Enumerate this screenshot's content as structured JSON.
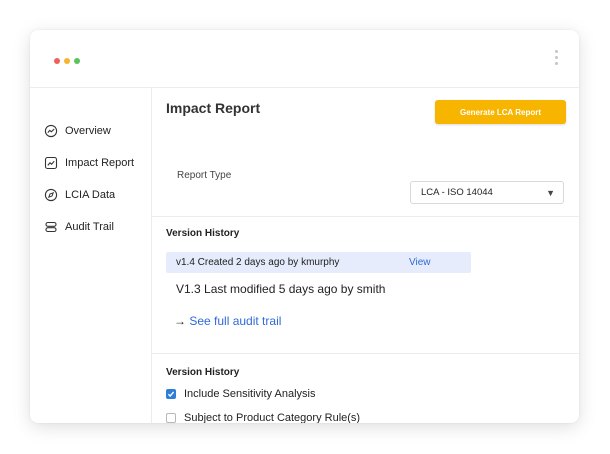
{
  "window": {
    "controls": [
      "close",
      "minimize",
      "maximize"
    ],
    "menu_icon": "vertical-ellipsis-icon"
  },
  "sidebar": {
    "items": [
      {
        "label": "Overview",
        "icon": "overview-chart-icon"
      },
      {
        "label": "Impact Report",
        "icon": "trend-line-icon"
      },
      {
        "label": "LCIA Data",
        "icon": "compass-icon"
      },
      {
        "label": "Audit Trail",
        "icon": "database-stack-icon"
      }
    ]
  },
  "main": {
    "title": "Impact Report",
    "generate_button": "Generate LCA Report",
    "report_type_label": "Report Type",
    "report_type_selected": "LCA - ISO 14044",
    "version_history": {
      "title": "Version History",
      "latest": {
        "text": "v1.4 Created 2 days ago by kmurphy",
        "action": "View"
      },
      "previous": "V1.3 Last modified 5 days ago by smith",
      "audit_link_arrow": "→",
      "audit_link": "See full audit trail"
    },
    "options": {
      "title": "Version History",
      "items": [
        {
          "label": "Include Sensitivity Analysis",
          "checked": true
        },
        {
          "label": "Subject to Product Category Rule(s)",
          "checked": false
        }
      ]
    }
  },
  "colors": {
    "accent_button": "#f7b500",
    "link": "#2f6ad8",
    "highlight_row": "#e6ecfb",
    "checkbox_checked": "#2f7ed8"
  }
}
